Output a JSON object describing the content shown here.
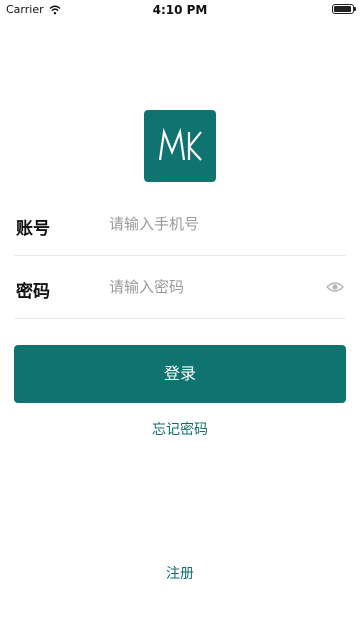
{
  "status_bar": {
    "carrier": "Carrier",
    "time": "4:10 PM"
  },
  "logo": {
    "text": "MK",
    "bg_color": "#0f7370"
  },
  "account": {
    "label": "账号",
    "placeholder": "请输入手机号",
    "value": ""
  },
  "password": {
    "label": "密码",
    "placeholder": "请输入密码",
    "value": "",
    "toggle_icon": "eye-icon"
  },
  "actions": {
    "login_label": "登录",
    "forgot_label": "忘记密码",
    "register_label": "注册"
  },
  "colors": {
    "accent": "#0f7370",
    "link": "#0f6f6c"
  }
}
